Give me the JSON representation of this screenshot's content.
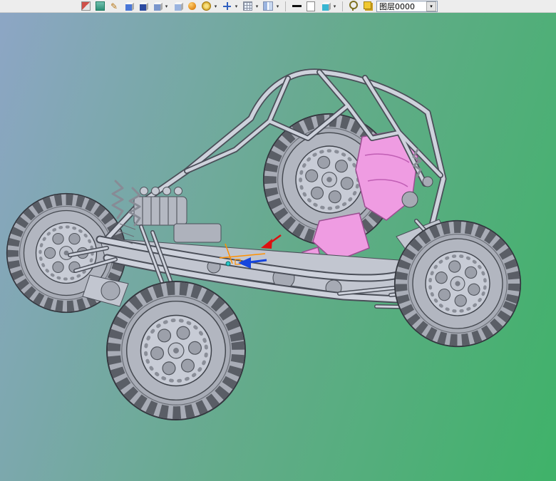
{
  "colors": {
    "bg-tl": "#8da6c5",
    "bg-mid": "#64ab8b",
    "bg-br": "#3fb269",
    "toolbar-bg": "#ededed",
    "model-light": "#ced2dc",
    "model-mid": "#c2c6d0",
    "model-dark": "#4a4e58",
    "seat-pink": "#ef9ce2",
    "seat-edge": "#9a4e90",
    "arrow-red": "#dd1010",
    "arrow-blue": "#1545dd",
    "manip-orange": "#ff9000"
  },
  "toolbar": {
    "caret": "▾",
    "pencil_glyph": "✎",
    "icons": [
      {
        "name": "sketch-icon"
      },
      {
        "name": "work-plane-icon"
      },
      {
        "name": "pencil-draft-icon"
      },
      {
        "name": "extrude-box-icon"
      },
      {
        "name": "revolve-box-icon"
      },
      {
        "name": "sweep-box-icon",
        "has_dropdown": true
      },
      {
        "name": "loft-box-icon"
      },
      {
        "name": "sphere-primitive-icon"
      },
      {
        "name": "fillet-icon",
        "has_dropdown": true
      },
      {
        "name": "move-icon",
        "has_dropdown": true
      },
      {
        "name": "array-pattern-icon",
        "has_dropdown": true
      },
      {
        "name": "mirror-icon",
        "has_dropdown": true
      },
      {
        "name": "line-width-icon"
      },
      {
        "name": "new-sheet-icon"
      },
      {
        "name": "render-mode-icon",
        "has_dropdown": true
      },
      {
        "name": "visibility-lamp-icon"
      },
      {
        "name": "layers-icon"
      }
    ],
    "layer_selector": {
      "value": "图层0000"
    }
  },
  "viewport": {
    "model": "off-road-buggy-3d-shaded"
  }
}
